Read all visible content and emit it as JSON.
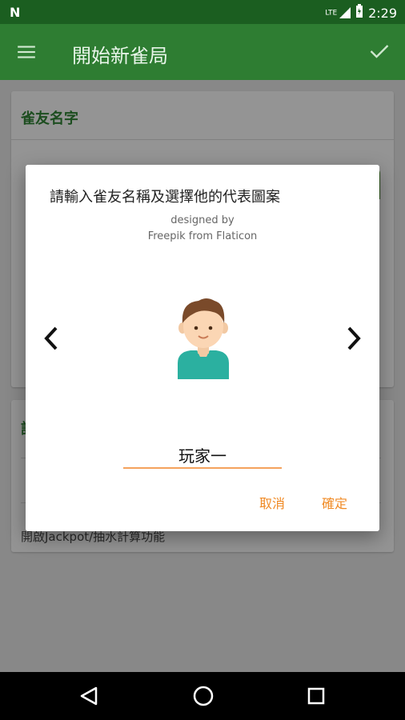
{
  "status_bar": {
    "signal_label": "LTE",
    "time": "2:29",
    "battery_level": "charging"
  },
  "app_bar": {
    "title": "開始新雀局"
  },
  "background": {
    "card1_header": "雀友名字",
    "card2_header": "設",
    "card2_text": "開啟Jackpot/抽水計算功能"
  },
  "dialog": {
    "heading": "請輸入雀友名稱及選擇他的代表圖案",
    "credit_line1": "designed by",
    "credit_line2": "Freepik from Flaticon",
    "name_value": "玩家一",
    "cancel_label": "取消",
    "confirm_label": "確定"
  },
  "colors": {
    "primary": "#2e7d32",
    "primary_dark": "#1b5e20",
    "accent": "#f08a24"
  }
}
